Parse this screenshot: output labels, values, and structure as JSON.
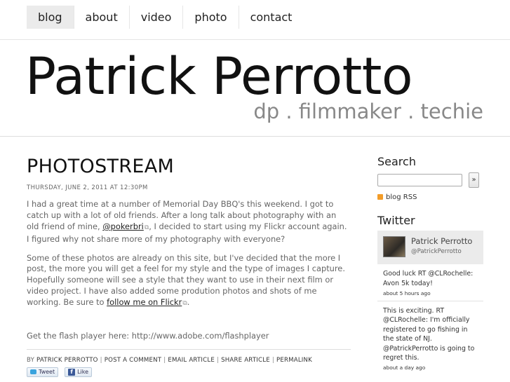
{
  "nav": {
    "items": [
      {
        "label": "blog"
      },
      {
        "label": "about"
      },
      {
        "label": "video"
      },
      {
        "label": "photo"
      },
      {
        "label": "contact"
      }
    ]
  },
  "header": {
    "title": "Patrick Perrotto",
    "tagline": "dp . filmmaker . techie"
  },
  "post": {
    "title": "PHOTOSTREAM",
    "date": "THURSDAY, JUNE 2, 2011 AT 12:30PM",
    "p1_a": "I had a great time at a number of Memorial Day BBQ's this weekend. I got to catch up with a lot of old friends. After a long talk about photography with an old friend of mine, ",
    "p1_link": "@pokerbri",
    "p1_b": ", I decided to start using my Flickr account again. I figured why not share more of my photography with everyone?",
    "p2_a": "Some of these photos are already on this site, but I've decided that the more I post, the more you will get a feel for my style and the type of images I capture.  Hopefully someone will see a style that they want to use in their next film or video project. I have also added some prodution photos and shots of me working. Be sure to ",
    "p2_link": "follow me on Flickr",
    "p2_b": ".",
    "flash": "Get the flash player here: http://www.adobe.com/flashplayer",
    "meta": {
      "by": "BY",
      "author": "PATRICK PERROTTO",
      "comment": "POST A COMMENT",
      "email": "EMAIL ARTICLE",
      "share": "SHARE ARTICLE",
      "permalink": "PERMALINK"
    },
    "tweet_label": "Tweet",
    "like_label": "Like"
  },
  "sidebar": {
    "search_heading": "Search",
    "search_button": "»",
    "rss_label": "blog RSS",
    "twitter_heading": "Twitter",
    "profile_name": "Patrick Perrotto",
    "profile_handle": "@PatrickPerrotto",
    "tweets": [
      {
        "text": "Good luck RT @CLRochelle: Avon 5k today!",
        "time": "about 5 hours ago"
      },
      {
        "text": "This is exciting. RT @CLRochelle: I'm officially registered to go fishing in the state of NJ. @PatrickPerrotto is going to regret this.",
        "time": "about a day ago"
      }
    ]
  },
  "colors": {
    "nav_active_bg": "#ebebeb",
    "tagline": "#888888",
    "rss": "#f39c28",
    "twitter": "#3aa3dd",
    "facebook": "#3b5998"
  }
}
